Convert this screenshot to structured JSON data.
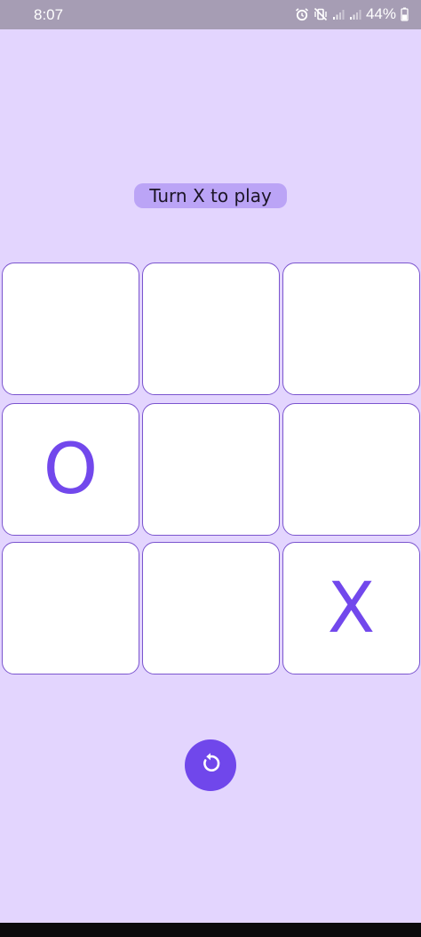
{
  "status_bar": {
    "time": "8:07",
    "battery": "44%",
    "icons": [
      "alarm-icon",
      "vibrate-off-icon",
      "signal-icon",
      "signal-icon",
      "battery-icon"
    ]
  },
  "game": {
    "turn_text": "Turn X to play",
    "cells": [
      "",
      "",
      "",
      "O",
      "",
      "",
      "",
      "",
      "X"
    ]
  },
  "controls": {
    "reset_icon": "restart-icon"
  },
  "colors": {
    "background": "#e3d5fe",
    "accent": "#7047eb",
    "pill": "#bba4f6",
    "cell_border": "#7b55cf"
  }
}
